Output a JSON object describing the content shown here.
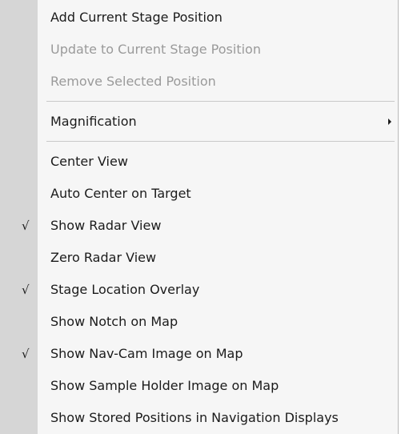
{
  "menu": {
    "group1": [
      {
        "label": "Add Current Stage Position"
      },
      {
        "label": "Update to Current Stage Position"
      },
      {
        "label": "Remove Selected Position"
      }
    ],
    "magnification": {
      "label": "Magnification",
      "has_submenu": true
    },
    "group3": [
      {
        "label": "Center View",
        "checked": false
      },
      {
        "label": "Auto Center on Target",
        "checked": false
      },
      {
        "label": "Show Radar View",
        "checked": true
      },
      {
        "label": "Zero Radar View",
        "checked": false
      },
      {
        "label": "Stage Location Overlay",
        "checked": true
      },
      {
        "label": "Show Notch on Map",
        "checked": false
      },
      {
        "label": "Show Nav-Cam Image on Map",
        "checked": true
      },
      {
        "label": "Show Sample Holder Image on Map",
        "checked": false
      },
      {
        "label": "Show Stored Positions in Navigation Displays",
        "checked": false
      }
    ],
    "check_glyph": "√",
    "colors": {
      "background": "#f6f6f6",
      "gutter": "#d6d6d6",
      "text": "#1b1b1b",
      "disabled_text": "#9a9a9a"
    }
  }
}
